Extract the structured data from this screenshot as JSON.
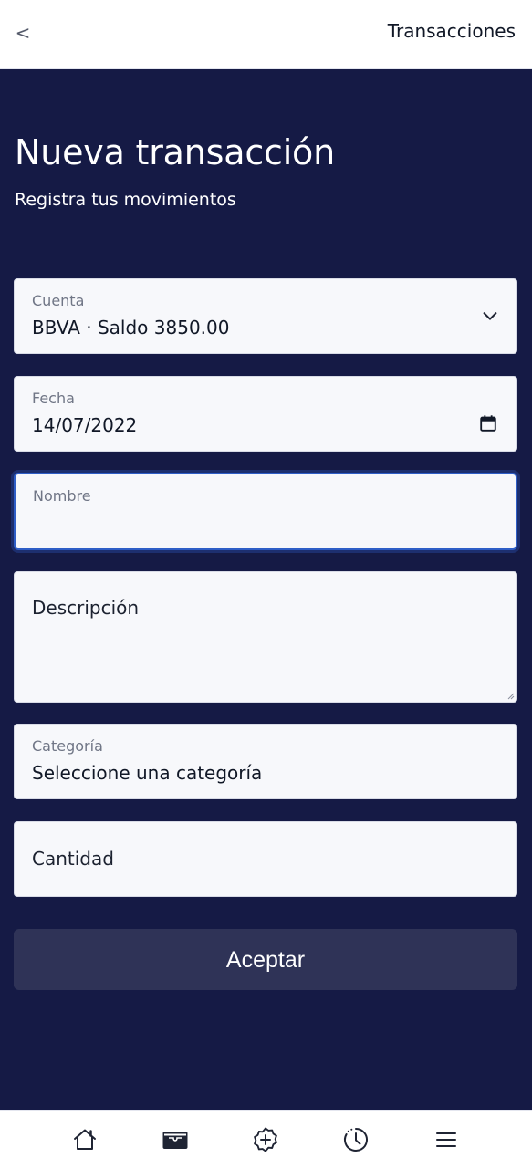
{
  "header": {
    "back_label": "<",
    "title": "Transacciones"
  },
  "page": {
    "title": "Nueva transacción",
    "subtitle": "Registra tus movimientos"
  },
  "form": {
    "cuenta": {
      "label": "Cuenta",
      "value": "BBVA · Saldo 3850.00"
    },
    "fecha": {
      "label": "Fecha",
      "value": "14/07/2022"
    },
    "nombre": {
      "label": "Nombre",
      "value": ""
    },
    "descripcion": {
      "placeholder": "Descripción"
    },
    "categoria": {
      "label": "Categoría",
      "value": "Seleccione una categoría"
    },
    "cantidad": {
      "placeholder": "Cantidad"
    },
    "submit_label": "Aceptar"
  },
  "bottom_nav": [
    {
      "icon": "home-icon"
    },
    {
      "icon": "wallet-icon"
    },
    {
      "icon": "add-badge-icon"
    },
    {
      "icon": "history-icon"
    },
    {
      "icon": "menu-icon"
    }
  ],
  "colors": {
    "background": "#151a45",
    "header_bg": "#ffffff",
    "field_bg": "#f7f8fb",
    "button_bg": "#2f3357",
    "focus_border": "#2e5ec7"
  }
}
